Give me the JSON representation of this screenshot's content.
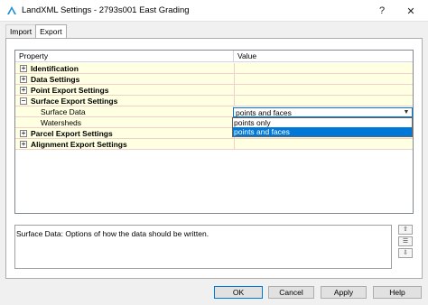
{
  "window": {
    "title": "LandXML Settings - 2793s001 East Grading",
    "help_glyph": "?",
    "close_glyph": "✕",
    "icon": "autocad-civil-icon"
  },
  "tabs": [
    {
      "label": "Import",
      "active": false
    },
    {
      "label": "Export",
      "active": true
    }
  ],
  "grid": {
    "headers": {
      "property": "Property",
      "value": "Value"
    },
    "rows": [
      {
        "kind": "category",
        "label": "Identification",
        "expander": "+"
      },
      {
        "kind": "category",
        "label": "Data Settings",
        "expander": "+"
      },
      {
        "kind": "category",
        "label": "Point Export Settings",
        "expander": "+"
      },
      {
        "kind": "category",
        "label": "Surface Export Settings",
        "expander": "−"
      },
      {
        "kind": "property",
        "label": "Surface Data",
        "value": "points and faces"
      },
      {
        "kind": "property",
        "label": "Watersheds",
        "value": ""
      },
      {
        "kind": "category",
        "label": "Parcel Export Settings",
        "expander": "+"
      },
      {
        "kind": "category",
        "label": "Alignment Export Settings",
        "expander": "+"
      }
    ]
  },
  "dropdown": {
    "selected_value": "points and faces",
    "arrow_icon": "chevron-down-icon",
    "options": [
      {
        "label": "points only",
        "selected": false
      },
      {
        "label": "points and faces",
        "selected": true
      }
    ]
  },
  "description": "Surface Data: Options of how the data should be written.",
  "side_tools": [
    "⇧",
    "☰",
    "⇩"
  ],
  "buttons": {
    "ok": "OK",
    "cancel": "Cancel",
    "apply": "Apply",
    "help": "Help"
  },
  "colors": {
    "accent": "#0078d7",
    "category_bg": "#ffffe1",
    "grid_line": "#f0cfcf"
  }
}
